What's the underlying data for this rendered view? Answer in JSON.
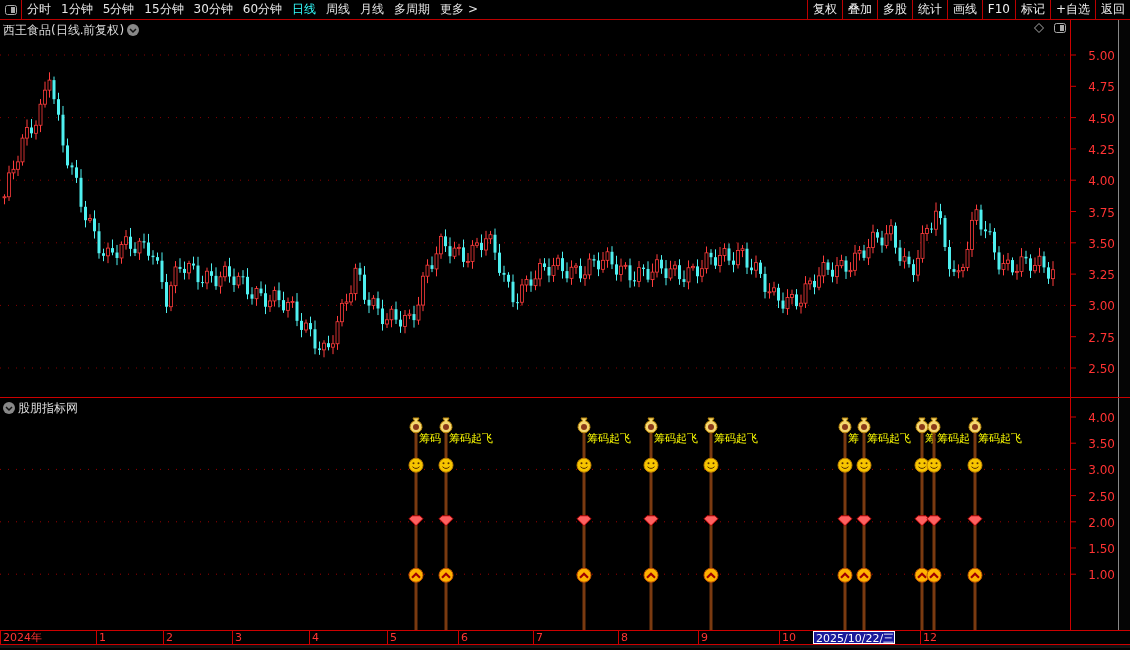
{
  "toolbar": {
    "periods": [
      {
        "label": "分时",
        "selected": false
      },
      {
        "label": "1分钟",
        "selected": false
      },
      {
        "label": "5分钟",
        "selected": false
      },
      {
        "label": "15分钟",
        "selected": false
      },
      {
        "label": "30分钟",
        "selected": false
      },
      {
        "label": "60分钟",
        "selected": false
      },
      {
        "label": "日线",
        "selected": true
      },
      {
        "label": "周线",
        "selected": false
      },
      {
        "label": "月线",
        "selected": false
      },
      {
        "label": "多周期",
        "selected": false
      }
    ],
    "more": "更多 >",
    "actions": [
      "复权",
      "叠加",
      "多股",
      "统计",
      "画线",
      "F10",
      "标记",
      "+自选",
      "返回"
    ]
  },
  "main_chart": {
    "title": "西王食品(日线.前复权)",
    "price_axis": [
      "5.00",
      "4.75",
      "4.50",
      "4.25",
      "4.00",
      "3.75",
      "3.50",
      "3.25",
      "3.00",
      "2.75",
      "2.50"
    ]
  },
  "indicator": {
    "title": "股朋指标网",
    "axis": [
      "4.00",
      "3.50",
      "3.00",
      "2.50",
      "2.00",
      "1.50",
      "1.00"
    ],
    "signals": [
      {
        "label": "筹码"
      },
      {
        "label": "筹码起飞"
      },
      {
        "label": "筹码起飞"
      },
      {
        "label": "筹码起飞"
      },
      {
        "label": "筹码起飞"
      },
      {
        "label": "筹"
      },
      {
        "label": "筹码起飞"
      },
      {
        "label": "筹"
      },
      {
        "label": "筹码起"
      },
      {
        "label": "筹码起飞"
      }
    ]
  },
  "date_axis": [
    {
      "label": "2024年",
      "selected": false
    },
    {
      "label": "1",
      "selected": false
    },
    {
      "label": "2",
      "selected": false
    },
    {
      "label": "3",
      "selected": false
    },
    {
      "label": "4",
      "selected": false
    },
    {
      "label": "5",
      "selected": false
    },
    {
      "label": "6",
      "selected": false
    },
    {
      "label": "7",
      "selected": false
    },
    {
      "label": "8",
      "selected": false
    },
    {
      "label": "9",
      "selected": false
    },
    {
      "label": "10",
      "selected": false
    },
    {
      "label": "2025/10/22/三",
      "selected": true
    },
    {
      "label": "12",
      "selected": false
    }
  ]
}
